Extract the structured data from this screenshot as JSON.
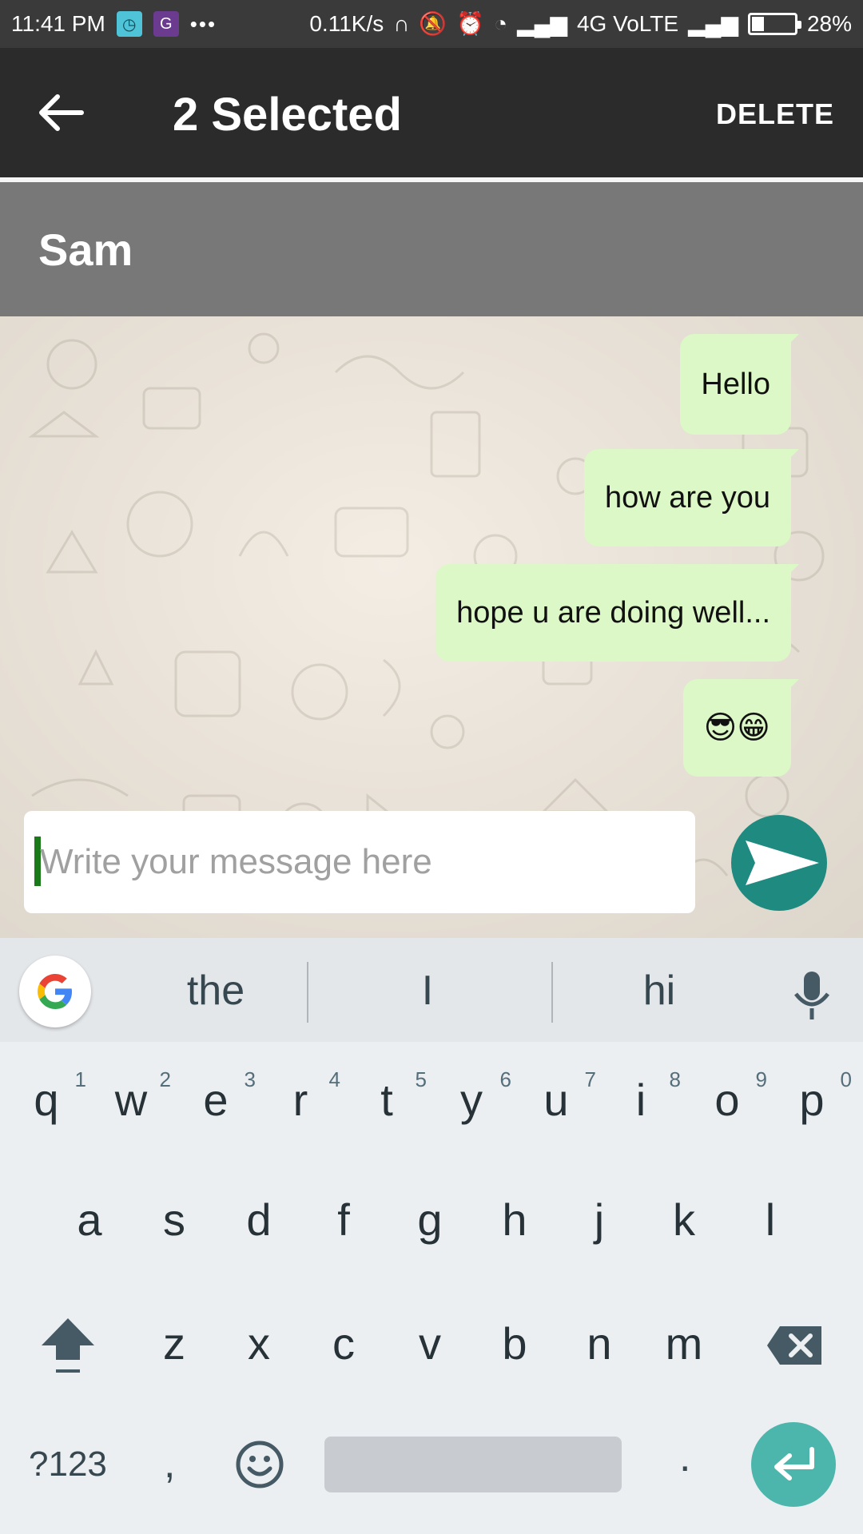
{
  "status_bar": {
    "time": "11:41 PM",
    "more": "•••",
    "net_speed": "0.11K/s",
    "network": "4G VoLTE",
    "battery": "28%",
    "battery_level": 0.28
  },
  "action_bar": {
    "title": "2 Selected",
    "delete_label": "DELETE"
  },
  "contact": {
    "name": "Sam"
  },
  "messages": [
    {
      "text": "Hello"
    },
    {
      "text": "how are you"
    },
    {
      "text": "hope u are doing well..."
    },
    {
      "text": "😎😁"
    }
  ],
  "composer": {
    "placeholder": "Write your message here",
    "value": ""
  },
  "keyboard": {
    "suggestions": [
      "the",
      "I",
      "hi"
    ],
    "row1": [
      {
        "key": "q",
        "hint": "1"
      },
      {
        "key": "w",
        "hint": "2"
      },
      {
        "key": "e",
        "hint": "3"
      },
      {
        "key": "r",
        "hint": "4"
      },
      {
        "key": "t",
        "hint": "5"
      },
      {
        "key": "y",
        "hint": "6"
      },
      {
        "key": "u",
        "hint": "7"
      },
      {
        "key": "i",
        "hint": "8"
      },
      {
        "key": "o",
        "hint": "9"
      },
      {
        "key": "p",
        "hint": "0"
      }
    ],
    "row2": [
      "a",
      "s",
      "d",
      "f",
      "g",
      "h",
      "j",
      "k",
      "l"
    ],
    "row3": [
      "z",
      "x",
      "c",
      "v",
      "b",
      "n",
      "m"
    ],
    "symbols_label": "?123",
    "comma": ",",
    "period": "."
  },
  "colors": {
    "action_bar": "#2b2b2b",
    "contact_bar": "#787878",
    "bubble": "#dcf8c6",
    "send_button": "#1e8a80",
    "enter_key": "#4db6ac"
  }
}
